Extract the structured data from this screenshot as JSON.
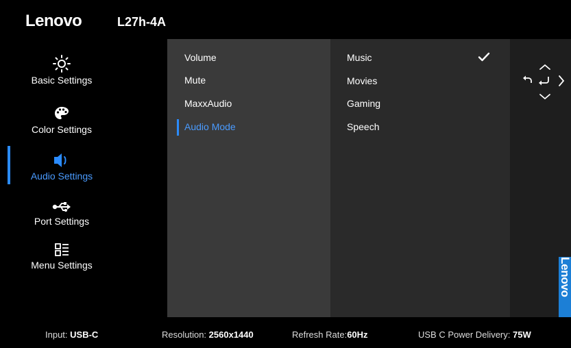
{
  "header": {
    "brand": "Lenovo",
    "model": "L27h-4A"
  },
  "sidebar": {
    "items": [
      {
        "label": "Basic Settings",
        "icon": "brightness-icon"
      },
      {
        "label": "Color Settings",
        "icon": "palette-icon"
      },
      {
        "label": "Audio Settings",
        "icon": "speaker-icon",
        "active": true
      },
      {
        "label": "Port Settings",
        "icon": "usb-icon"
      },
      {
        "label": "Menu Settings",
        "icon": "menu-grid-icon"
      }
    ]
  },
  "audio_menu": {
    "items": [
      "Volume",
      "Mute",
      "MaxxAudio",
      "Audio Mode"
    ],
    "active": "Audio Mode"
  },
  "audio_mode_options": {
    "items": [
      "Music",
      "Movies",
      "Gaming",
      "Speech"
    ],
    "selected": "Music"
  },
  "navigation": {
    "icons": [
      "chevron-up-icon",
      "back-icon",
      "enter-icon",
      "chevron-right-icon",
      "chevron-down-icon"
    ]
  },
  "side_tab": {
    "text": "Lenovo"
  },
  "footer": {
    "input_label": "Input:",
    "input_value": "USB-C",
    "resolution_label": "Resolution:",
    "resolution_value": "2560x1440",
    "refresh_label": "Refresh Rate:",
    "refresh_value": "60Hz",
    "power_label": "USB C Power Delivery:",
    "power_value": "75W"
  },
  "colors": {
    "accent": "#2b8cff",
    "panel_mid": "#3a3a3a",
    "panel_right": "#2a2a2a",
    "brand_tab": "#1c7fd6"
  }
}
